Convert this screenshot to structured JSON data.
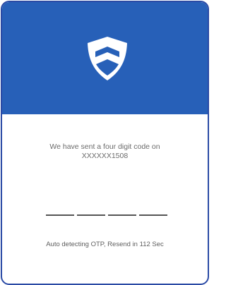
{
  "colors": {
    "brand": "#2760b8",
    "border": "#2a4aa5",
    "text": "#6b6b6b"
  },
  "header": {
    "icon": "shield-icon"
  },
  "message": {
    "line1": "We have sent a four digit code on",
    "line2": "XXXXXX1508"
  },
  "otp": {
    "digits": [
      "",
      "",
      "",
      ""
    ]
  },
  "status": {
    "prefix": "Auto detecting OTP, Resend in",
    "seconds": "112",
    "unit": "Sec"
  }
}
